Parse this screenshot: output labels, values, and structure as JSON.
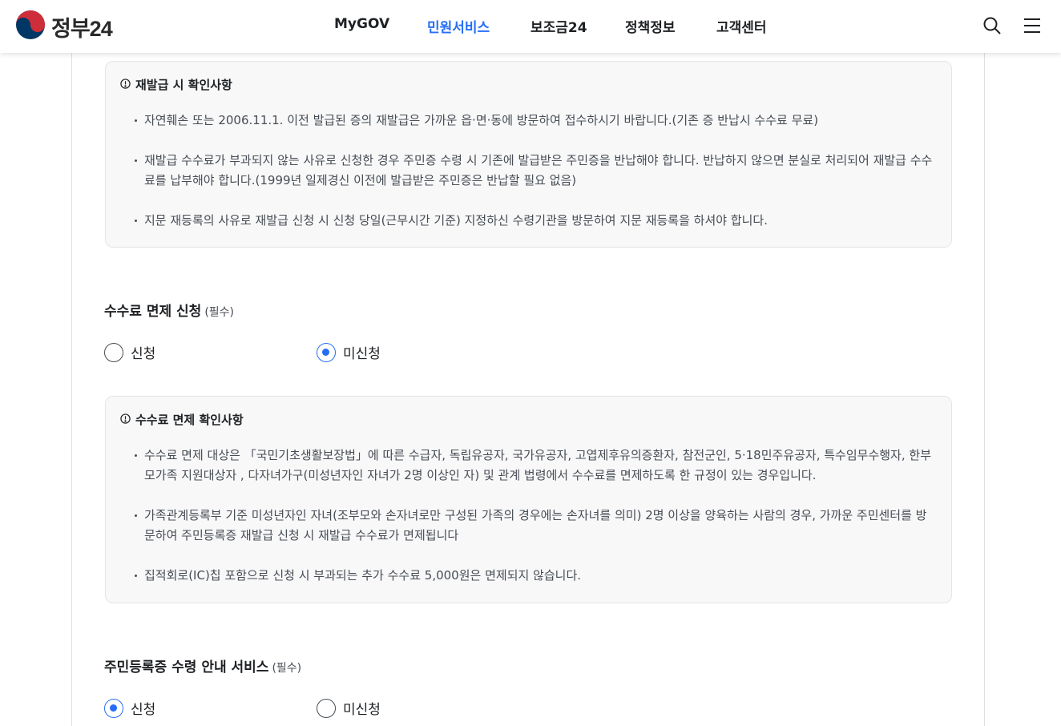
{
  "header": {
    "logo_text": "정부24",
    "nav": [
      {
        "label": "MyGOV",
        "active": false
      },
      {
        "label": "민원서비스",
        "active": true
      },
      {
        "label": "보조금24",
        "active": false
      },
      {
        "label": "정책정보",
        "active": false
      },
      {
        "label": "고객센터",
        "active": false
      }
    ],
    "icons": [
      "search-icon",
      "menu-icon"
    ],
    "accent_color": "#256ef4"
  },
  "reissue_notice": {
    "title": "재발급 시 확인사항",
    "items": [
      "자연훼손 또는 2006.11.1. 이전 발급된 증의 재발급은 가까운 읍·면·동에 방문하여 접수하시기 바랍니다.(기존 증 반납시 수수료 무료)",
      "재발급 수수료가 부과되지 않는 사유로 신청한 경우 주민증 수령 시 기존에 발급받은 주민증을 반납해야 합니다. 반납하지 않으면 분실로 처리되어 재발급 수수료를 납부해야 합니다.(1999년 일제경신 이전에 발급받은 주민증은 반납할 필요 없음)",
      "지문 재등록의 사유로 재발급 신청 시 신청 당일(근무시간 기준) 지정하신 수령기관을 방문하여 지문 재등록을 하셔야 합니다."
    ]
  },
  "fee_exemption": {
    "title": "수수료 면제 신청",
    "required": "(필수)",
    "options": [
      {
        "label": "신청",
        "checked": false
      },
      {
        "label": "미신청",
        "checked": true
      }
    ]
  },
  "fee_notice": {
    "title": "수수료 면제 확인사항",
    "items": [
      "수수료 면제 대상은 「국민기초생활보장법」에 따른 수급자, 독립유공자, 국가유공자, 고엽제후유의증환자, 참전군인, 5·18민주유공자, 특수임무수행자, 한부모가족 지원대상자 , 다자녀가구(미성년자인 자녀가 2명 이상인 자) 및 관계 법령에서 수수료를 면제하도록 한 규정이 있는 경우입니다.",
      "가족관계등록부 기준 미성년자인 자녀(조부모와 손자녀로만 구성된 가족의 경우에는 손자녀를 의미) 2명 이상을 양육하는 사람의 경우, 가까운 주민센터를 방문하여 주민등록증 재발급 신청 시 재발급 수수료가 면제됩니다",
      "집적회로(IC)칩 포함으로 신청 시 부과되는 추가 수수료 5,000원은 면제되지 않습니다."
    ]
  },
  "pickup_service": {
    "title": "주민등록증 수령 안내 서비스",
    "required": "(필수)",
    "options": [
      {
        "label": "신청",
        "checked": true
      },
      {
        "label": "미신청",
        "checked": false
      }
    ]
  }
}
